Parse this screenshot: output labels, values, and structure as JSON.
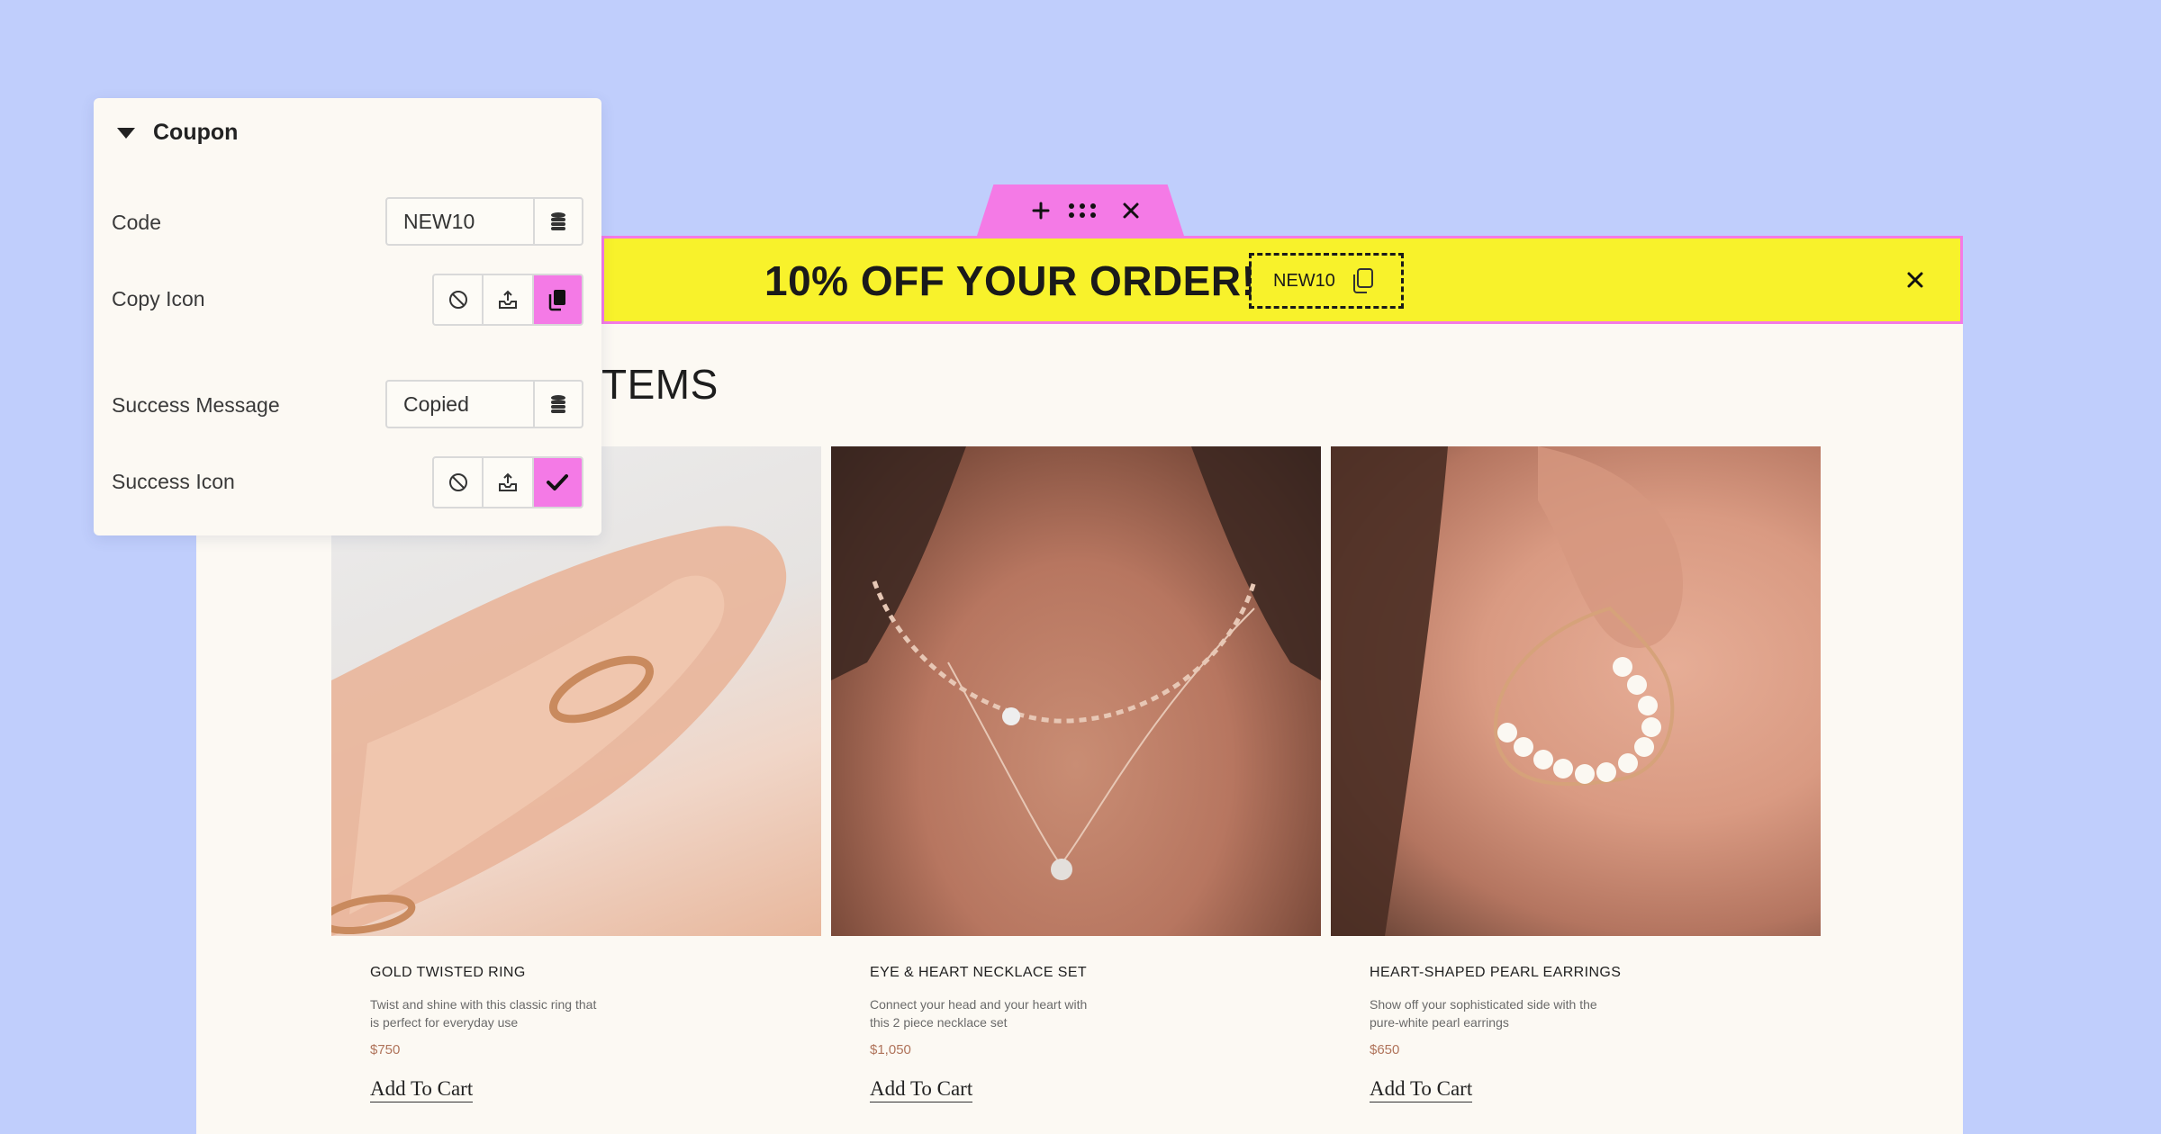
{
  "panel": {
    "title": "Coupon",
    "code": {
      "label": "Code",
      "value": "NEW10"
    },
    "copy_icon": {
      "label": "Copy Icon",
      "selected": "copy-icon"
    },
    "success_message": {
      "label": "Success Message",
      "value": "Copied"
    },
    "success_icon": {
      "label": "Success Icon",
      "selected": "check-icon"
    }
  },
  "announcement": {
    "text": "10% OFF YOUR ORDER!",
    "coupon_code": "NEW10"
  },
  "store": {
    "heading": "TEMS",
    "products": [
      {
        "name": "GOLD TWISTED RING",
        "desc": "Twist and shine with this classic ring that is perfect for everyday use",
        "price": "$750",
        "cta": "Add To Cart"
      },
      {
        "name": "EYE & HEART NECKLACE SET",
        "desc": "Connect your head and your heart with this 2 piece necklace set",
        "price": "$1,050",
        "cta": "Add To Cart"
      },
      {
        "name": "HEART-SHAPED PEARL EARRINGS",
        "desc": "Show off your sophisticated side with the pure-white pearl earrings",
        "price": "$650",
        "cta": "Add To Cart"
      }
    ]
  },
  "colors": {
    "accent_pink": "#f47ae6",
    "bar_yellow": "#f8f22b",
    "background": "#c0cefc",
    "price": "#b0745b"
  }
}
